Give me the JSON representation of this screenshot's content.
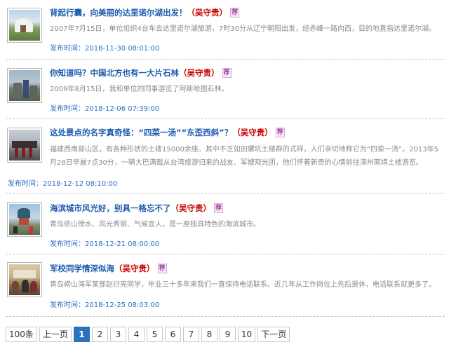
{
  "articles": [
    {
      "title": "背起行囊，向美丽的达里诺尔湖出发！",
      "author": "（吴守贵）",
      "badge": "荐",
      "summary": "2007年7月15日，单位组织4台车去达里诺尔湖旅游，7时30分从辽宁朝阳出发，经赤峰一路向西，目的地直指达里诺尔湖。",
      "time_label": "发布时间：",
      "time": "2018-11-30 08:01:00"
    },
    {
      "title": "你知道吗？中国北方也有一大片石林",
      "author": "（吴守贵）",
      "badge": "荐",
      "summary": "2009年8月15日，我和单位的同事游览了阿斯哈图石林。",
      "time_label": "发布时间：",
      "time": "2018-12-06 07:39:00"
    },
    {
      "title": "这处景点的名字真奇怪：“四菜一汤”“东歪西斜”？",
      "author": "（吴守贵）",
      "badge": "荐",
      "summary": "福建西南部山区，有各种形状的土楼15000余座。其中不乏如田螺坑土楼群的式样，人们亲切地称它为“四菜一汤”。2013年5月28日早晨7点30分，一辆大巴满载从台湾旅游归来的战友、军嫂观光团，他们怀着新奇的心情前往漳州南靖土楼游览。",
      "time_label": "发布时间：",
      "time": "2018-12-12 08:10:00"
    },
    {
      "title": "海滨城市风光好，别具一格忘不了",
      "author": "（吴守贵）",
      "badge": "荐",
      "summary": "青岛依山傍水、风光秀丽、气候宜人，是一座独具特色的海滨城市。",
      "time_label": "发布时间：",
      "time": "2018-12-21 08:00:00"
    },
    {
      "title": "军校同学情深似海",
      "author": "（吴守贵）",
      "badge": "荐",
      "summary": "青岛崂山海军某部赵衍亮同学，毕业三十多年来我们一直保持电话联系。近几年从工作岗位上先后退休，电话联系就更多了。",
      "time_label": "发布时间：",
      "time": "2018-12-25 08:03:00"
    }
  ],
  "pagination": {
    "total": "100条",
    "prev": "上一页",
    "pages": [
      "1",
      "2",
      "3",
      "4",
      "5",
      "6",
      "7",
      "8",
      "9",
      "10"
    ],
    "current": "1",
    "next": "下一页"
  },
  "colors": {
    "title": "#1d5cae",
    "author": "#cc0000",
    "summary": "#8a8a8a",
    "time": "#2b6fc6",
    "badge": "#a33aa0",
    "pager_active": "#2b73c0"
  },
  "icons": {
    "badge": "recommend-badge-icon"
  }
}
